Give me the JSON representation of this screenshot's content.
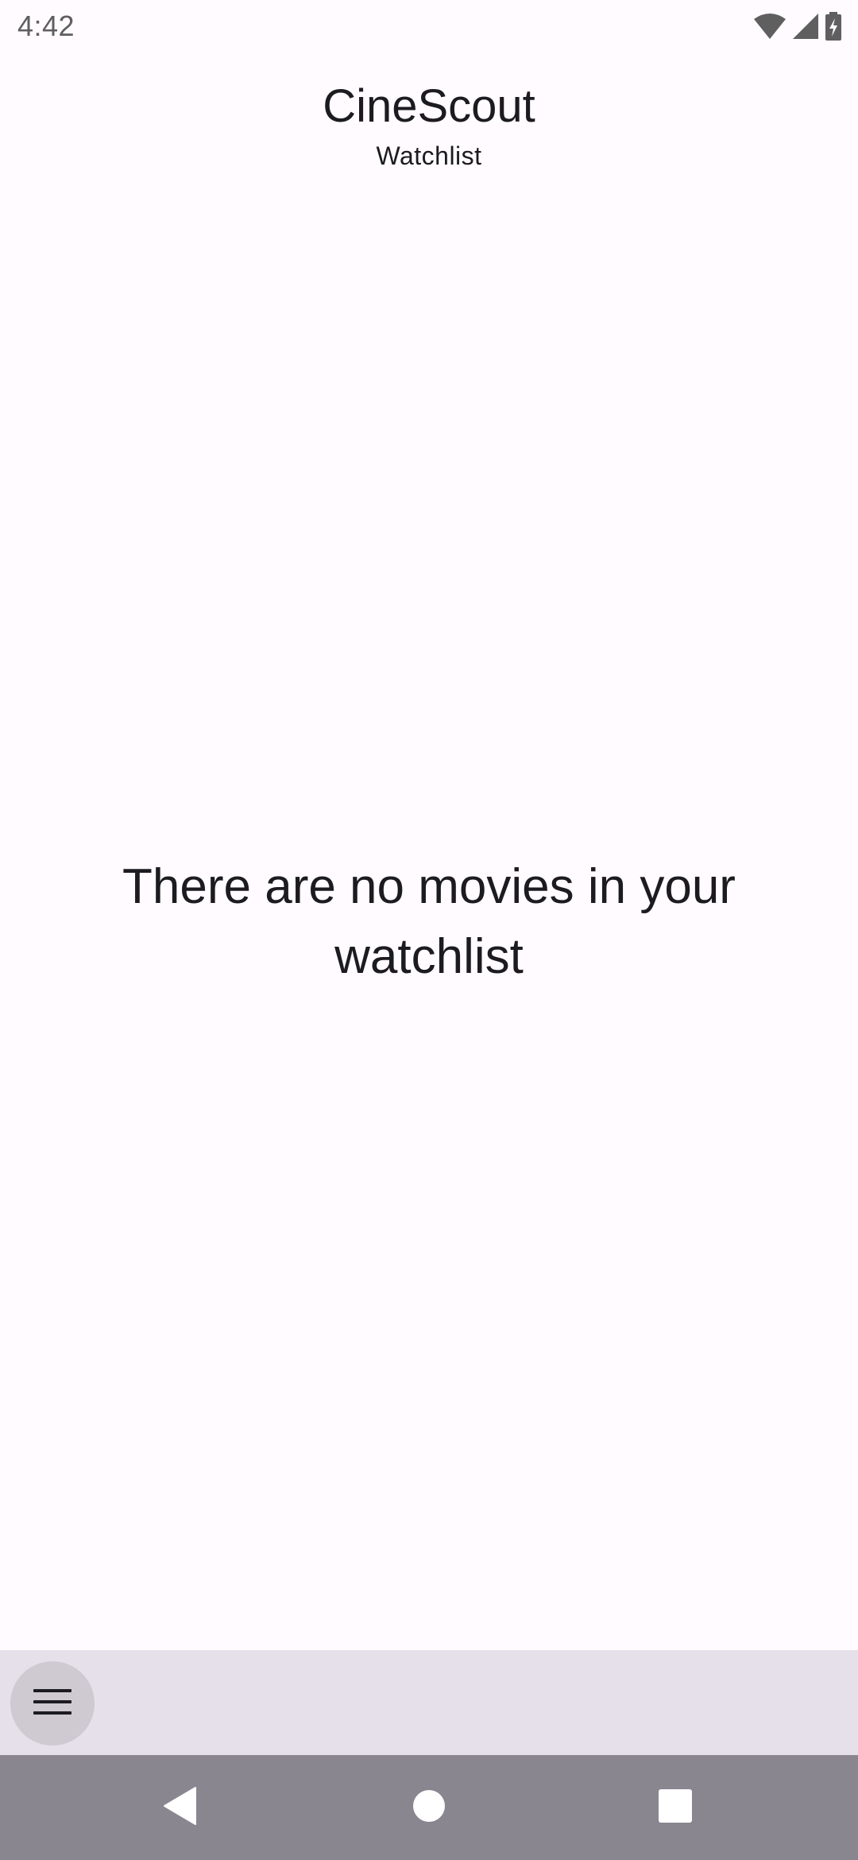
{
  "status_bar": {
    "time": "4:42",
    "icons": [
      "wifi-icon",
      "signal-icon",
      "battery-charging-icon"
    ]
  },
  "header": {
    "title": "CineScout",
    "subtitle": "Watchlist"
  },
  "main": {
    "empty_message": "There are no movies in your watchlist"
  },
  "bottom_bar": {
    "menu_icon": "menu-icon"
  },
  "navigation_bar": {
    "buttons": [
      "back-icon",
      "home-icon",
      "recents-icon"
    ]
  },
  "colors": {
    "background": "#fffbfe",
    "bottom_bar": "#e6e0ea",
    "menu_button": "#cfc9d1",
    "navigation_bar": "#8a8690",
    "text": "#1c1b1f"
  }
}
